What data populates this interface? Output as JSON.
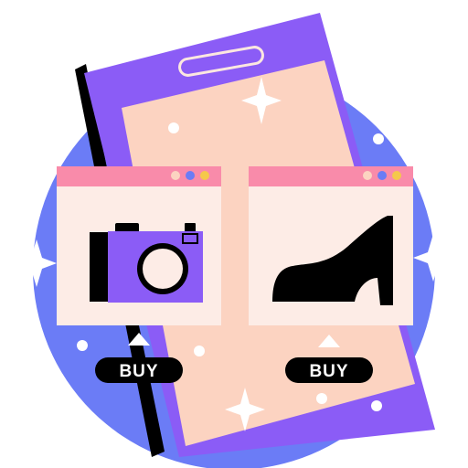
{
  "illustration": {
    "colors": {
      "background_circle": "#6B7CF6",
      "phone_body": "#8B5CF6",
      "phone_screen": "#FCD3C1",
      "window_header": "#F98BAA",
      "window_body": "#FDECE6",
      "ink": "#000000",
      "camera_accent": "#8B5CF6",
      "window_dots": [
        "#FCD3C1",
        "#6B7CF6",
        "#F5C84B"
      ]
    },
    "cards": [
      {
        "product_icon": "camera-icon",
        "buy_label": "BUY"
      },
      {
        "product_icon": "high-heel-shoe-icon",
        "buy_label": "BUY"
      }
    ]
  }
}
